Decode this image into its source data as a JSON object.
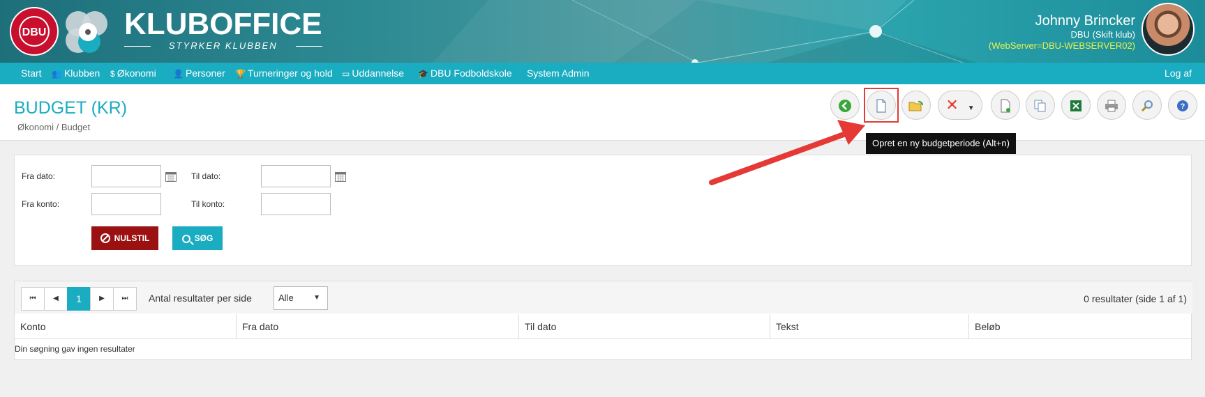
{
  "header": {
    "brand_title": "KLUBOFFICE",
    "brand_subtitle": "STYRKER KLUBBEN",
    "dbu_logo_text": "DBU",
    "user_name": "Johnny Brincker",
    "user_club": "DBU (Skift klub)",
    "server": "(WebServer=DBU-WEBSERVER02)"
  },
  "nav": {
    "items": [
      {
        "label": "Start",
        "icon": ""
      },
      {
        "label": "Klubben",
        "icon": "people-icon"
      },
      {
        "label": "Økonomi",
        "icon": "coin-icon"
      },
      {
        "label": "Personer",
        "icon": "person-icon"
      },
      {
        "label": "Turneringer og hold",
        "icon": "trophy-icon"
      },
      {
        "label": "Uddannelse",
        "icon": "presentation-icon"
      },
      {
        "label": "DBU Fodboldskole",
        "icon": "graduation-cap-icon"
      },
      {
        "label": "System Admin",
        "icon": ""
      }
    ],
    "logout": "Log af"
  },
  "page": {
    "title": "BUDGET (KR)",
    "breadcrumb": "Økonomi / Budget"
  },
  "toolbar": {
    "tooltip": "Opret en ny budgetperiode (Alt+n)"
  },
  "search": {
    "fra_dato_label": "Fra dato:",
    "til_dato_label": "Til dato:",
    "fra_konto_label": "Fra konto:",
    "til_konto_label": "Til konto:",
    "fra_dato_value": "",
    "til_dato_value": "",
    "fra_konto_value": "",
    "til_konto_value": "",
    "reset_label": "NULSTIL",
    "search_label": "SØG"
  },
  "results": {
    "current_page": "1",
    "per_page_label": "Antal resultater per side",
    "per_page_value": "Alle",
    "count_text": "0 resultater (side 1 af 1)",
    "columns": [
      "Konto",
      "Fra dato",
      "Til dato",
      "Tekst",
      "Beløb"
    ],
    "empty_text": "Din søgning gav ingen resultater"
  },
  "colors": {
    "accent": "#1aacc0",
    "reset": "#9b1111",
    "highlight": "#e53935",
    "server_text": "#eaf34a"
  }
}
